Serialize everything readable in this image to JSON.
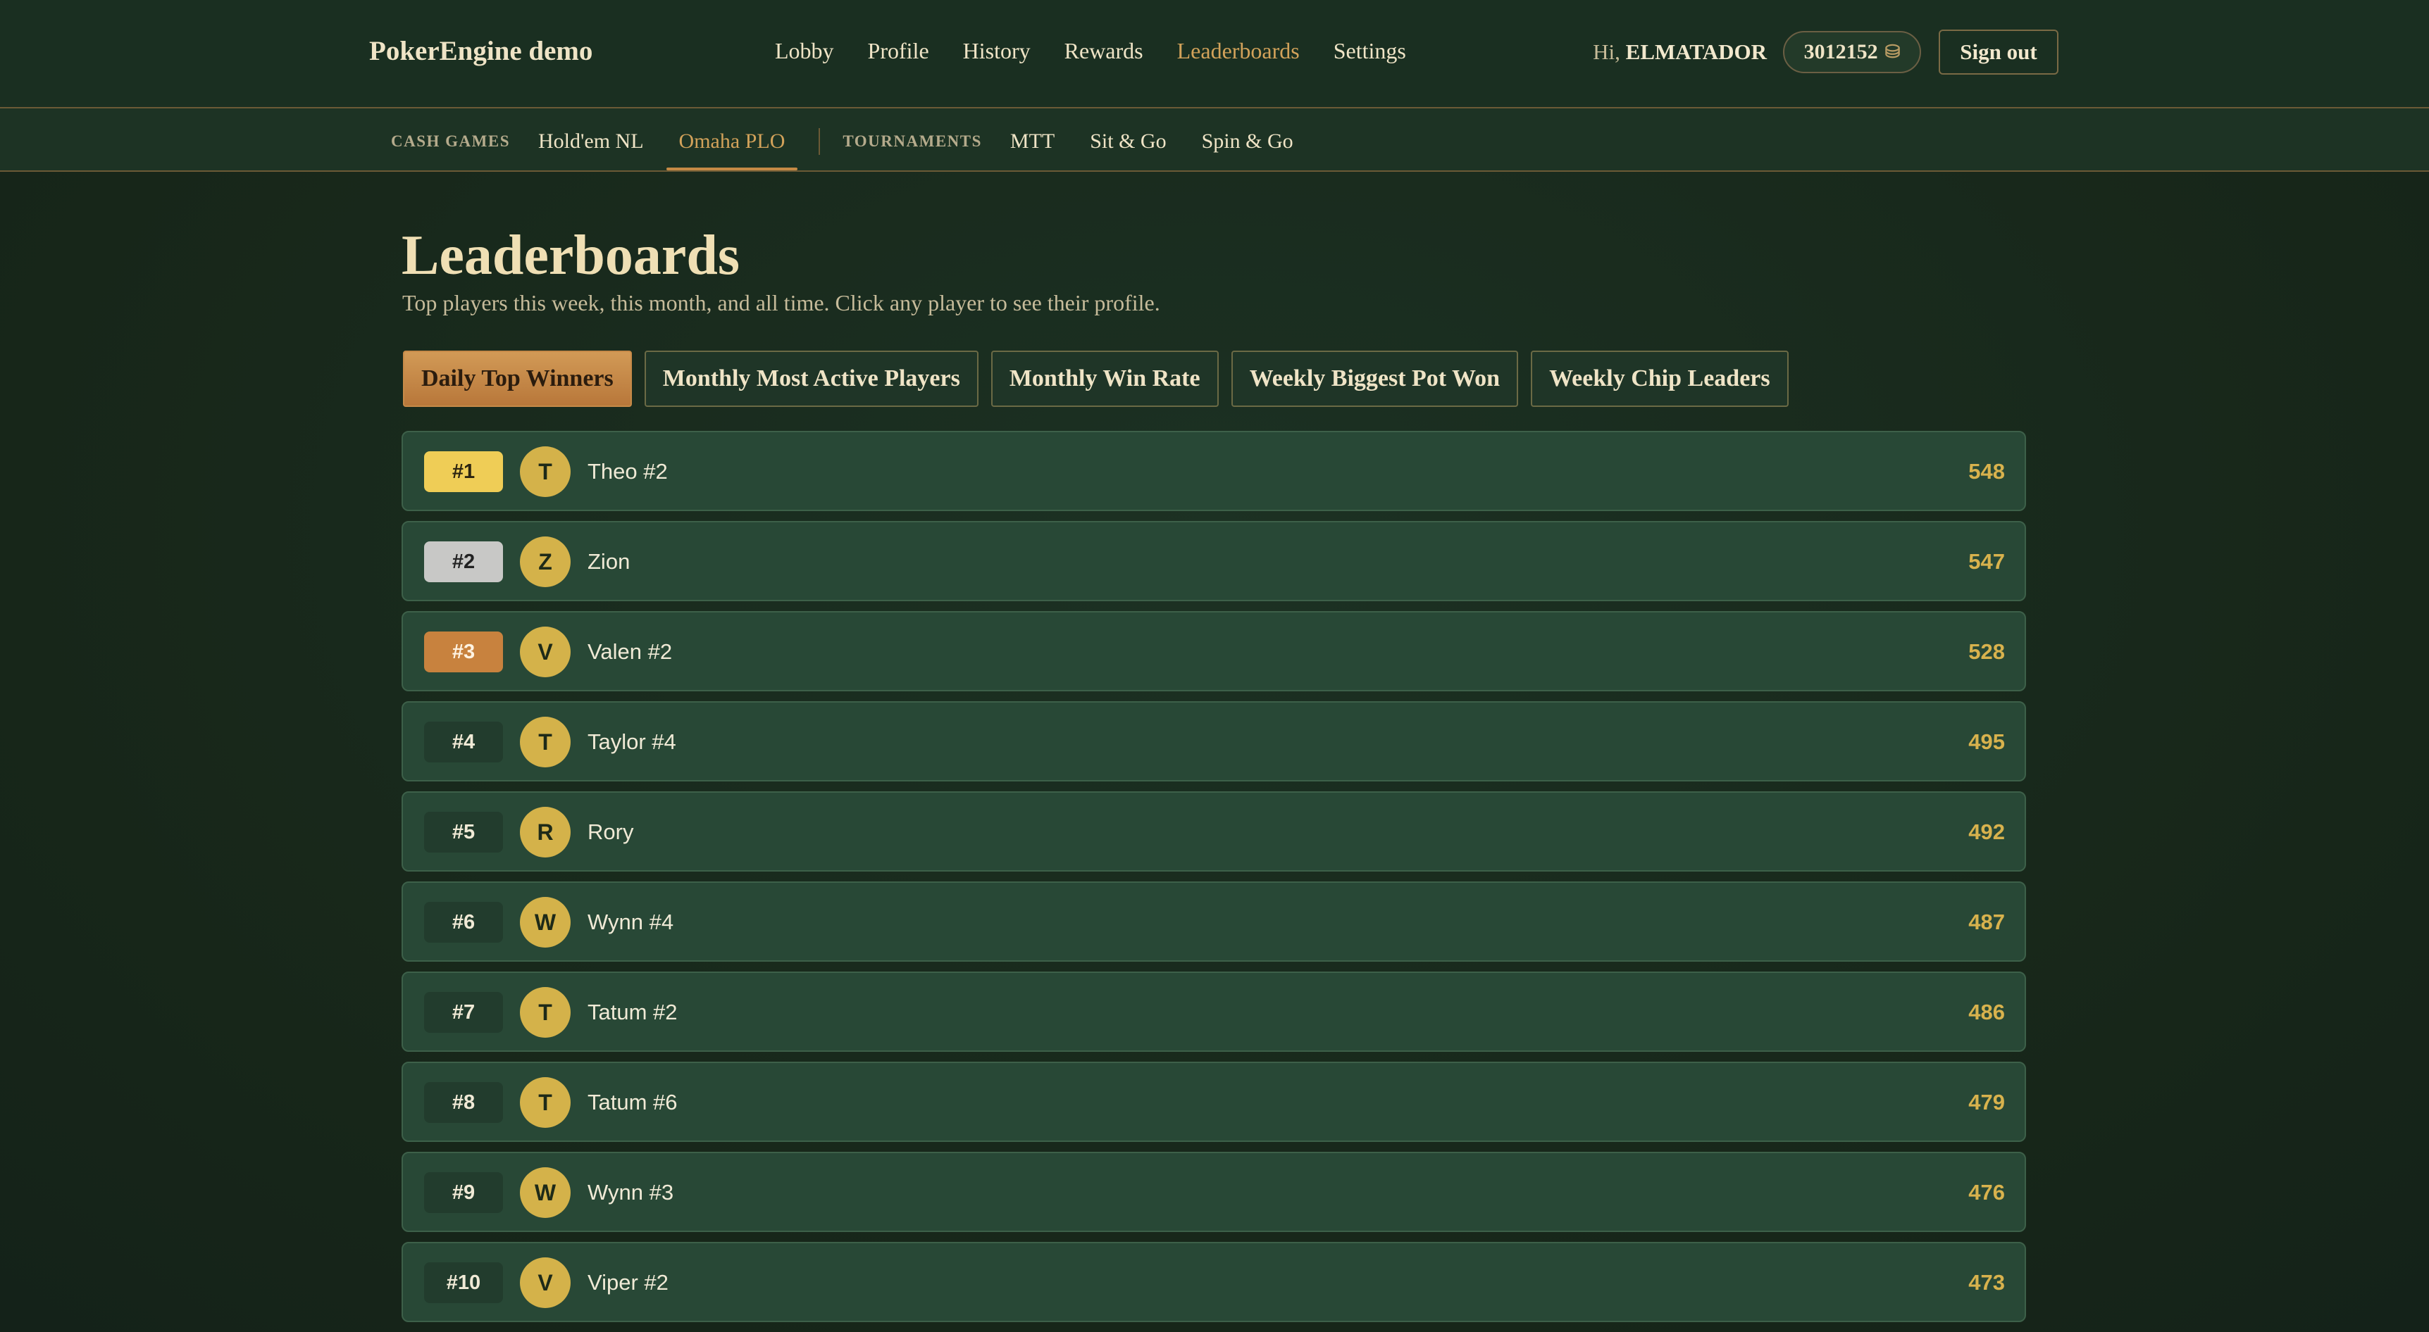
{
  "header": {
    "brand": "PokerEngine demo",
    "nav": [
      "Lobby",
      "Profile",
      "History",
      "Rewards",
      "Leaderboards",
      "Settings"
    ],
    "active_nav": "Leaderboards",
    "greeting_prefix": "Hi,",
    "username": "ELMATADOR",
    "balance": "3012152",
    "coin_icon": "⛁",
    "signout_label": "Sign out"
  },
  "subnav": {
    "cash_label": "CASH GAMES",
    "cash_items": [
      "Hold'em NL",
      "Omaha PLO"
    ],
    "active_item": "Omaha PLO",
    "tournaments_label": "TOURNAMENTS",
    "tournament_items": [
      "MTT",
      "Sit & Go",
      "Spin & Go"
    ]
  },
  "page": {
    "title": "Leaderboards",
    "subtitle": "Top players this week, this month, and all time. Click any player to see their profile.",
    "tabs": [
      "Daily Top Winners",
      "Monthly Most Active Players",
      "Monthly Win Rate",
      "Weekly Biggest Pot Won",
      "Weekly Chip Leaders"
    ],
    "active_tab": "Daily Top Winners"
  },
  "leaderboard": [
    {
      "rank": "#1",
      "initial": "T",
      "name": "Theo #2",
      "score": "548",
      "medal": "gold"
    },
    {
      "rank": "#2",
      "initial": "Z",
      "name": "Zion",
      "score": "547",
      "medal": "silver"
    },
    {
      "rank": "#3",
      "initial": "V",
      "name": "Valen #2",
      "score": "528",
      "medal": "bronze"
    },
    {
      "rank": "#4",
      "initial": "T",
      "name": "Taylor #4",
      "score": "495",
      "medal": ""
    },
    {
      "rank": "#5",
      "initial": "R",
      "name": "Rory",
      "score": "492",
      "medal": ""
    },
    {
      "rank": "#6",
      "initial": "W",
      "name": "Wynn #4",
      "score": "487",
      "medal": ""
    },
    {
      "rank": "#7",
      "initial": "T",
      "name": "Tatum #2",
      "score": "486",
      "medal": ""
    },
    {
      "rank": "#8",
      "initial": "T",
      "name": "Tatum #6",
      "score": "479",
      "medal": ""
    },
    {
      "rank": "#9",
      "initial": "W",
      "name": "Wynn #3",
      "score": "476",
      "medal": ""
    },
    {
      "rank": "#10",
      "initial": "V",
      "name": "Viper #2",
      "score": "473",
      "medal": ""
    }
  ]
}
